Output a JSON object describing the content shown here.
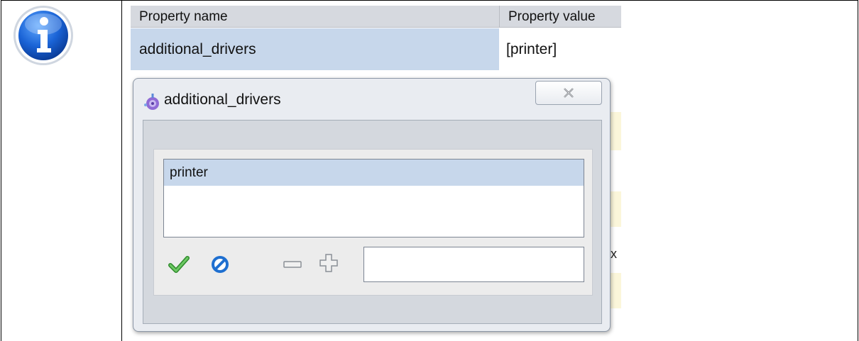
{
  "table": {
    "header_name": "Property name",
    "header_value": "Property value",
    "row_name": "additional_drivers",
    "row_value": "[printer]"
  },
  "dialog": {
    "title": "additional_drivers",
    "list_items": [
      "printer"
    ],
    "input_value": "",
    "peek_text": "x"
  },
  "icons": {
    "info": "info-icon",
    "dialog": "app-gear-icon",
    "close": "close-icon",
    "ok": "checkmark-icon",
    "cancel": "cancel-icon",
    "remove": "minus-icon",
    "add": "plus-icon"
  },
  "colors": {
    "selection": "#c7d7eb",
    "accent_green": "#3fa63a",
    "accent_blue": "#1e6fd0"
  }
}
